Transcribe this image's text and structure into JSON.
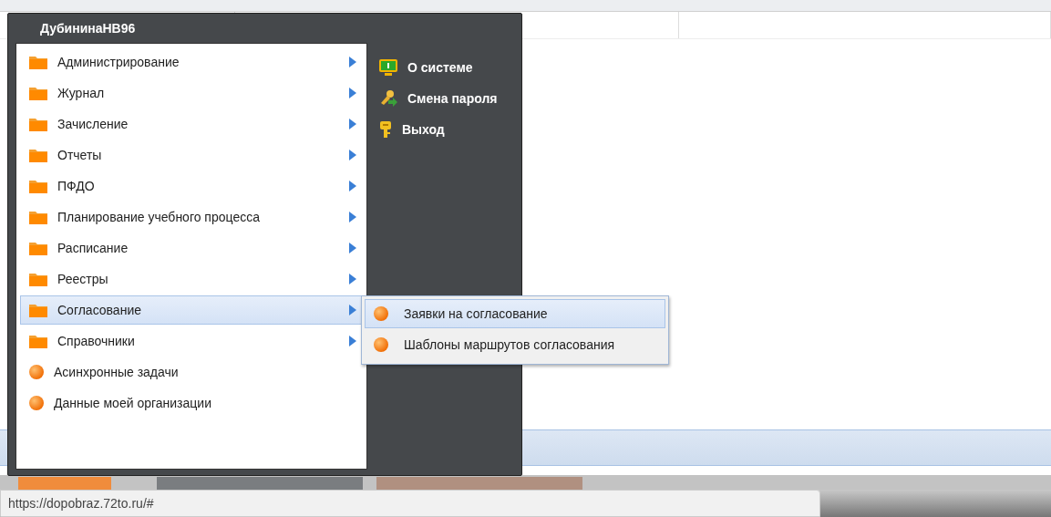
{
  "start_menu": {
    "user": "ДубининаНВ96",
    "items": [
      {
        "label": "Администрирование",
        "kind": "folder",
        "selected": false
      },
      {
        "label": "Журнал",
        "kind": "folder",
        "selected": false
      },
      {
        "label": "Зачисление",
        "kind": "folder",
        "selected": false
      },
      {
        "label": "Отчеты",
        "kind": "folder",
        "selected": false
      },
      {
        "label": "ПФДО",
        "kind": "folder",
        "selected": false
      },
      {
        "label": "Планирование учебного процесса",
        "kind": "folder",
        "selected": false
      },
      {
        "label": "Расписание",
        "kind": "folder",
        "selected": false
      },
      {
        "label": "Реестры",
        "kind": "folder",
        "selected": false
      },
      {
        "label": "Согласование",
        "kind": "folder",
        "selected": true
      },
      {
        "label": "Справочники",
        "kind": "folder",
        "selected": false
      },
      {
        "label": "Асинхронные задачи",
        "kind": "task",
        "selected": false
      },
      {
        "label": "Данные моей организации",
        "kind": "task",
        "selected": false
      }
    ],
    "actions": [
      {
        "label": "О системе",
        "kind": "info"
      },
      {
        "label": "Смена пароля",
        "kind": "password"
      },
      {
        "label": "Выход",
        "kind": "exit"
      }
    ]
  },
  "submenu": {
    "items": [
      {
        "label": "Заявки на согласование",
        "selected": true
      },
      {
        "label": "Шаблоны маршрутов согласования",
        "selected": false
      }
    ]
  },
  "status_bar": {
    "url": "https://dopobraz.72to.ru/#"
  }
}
